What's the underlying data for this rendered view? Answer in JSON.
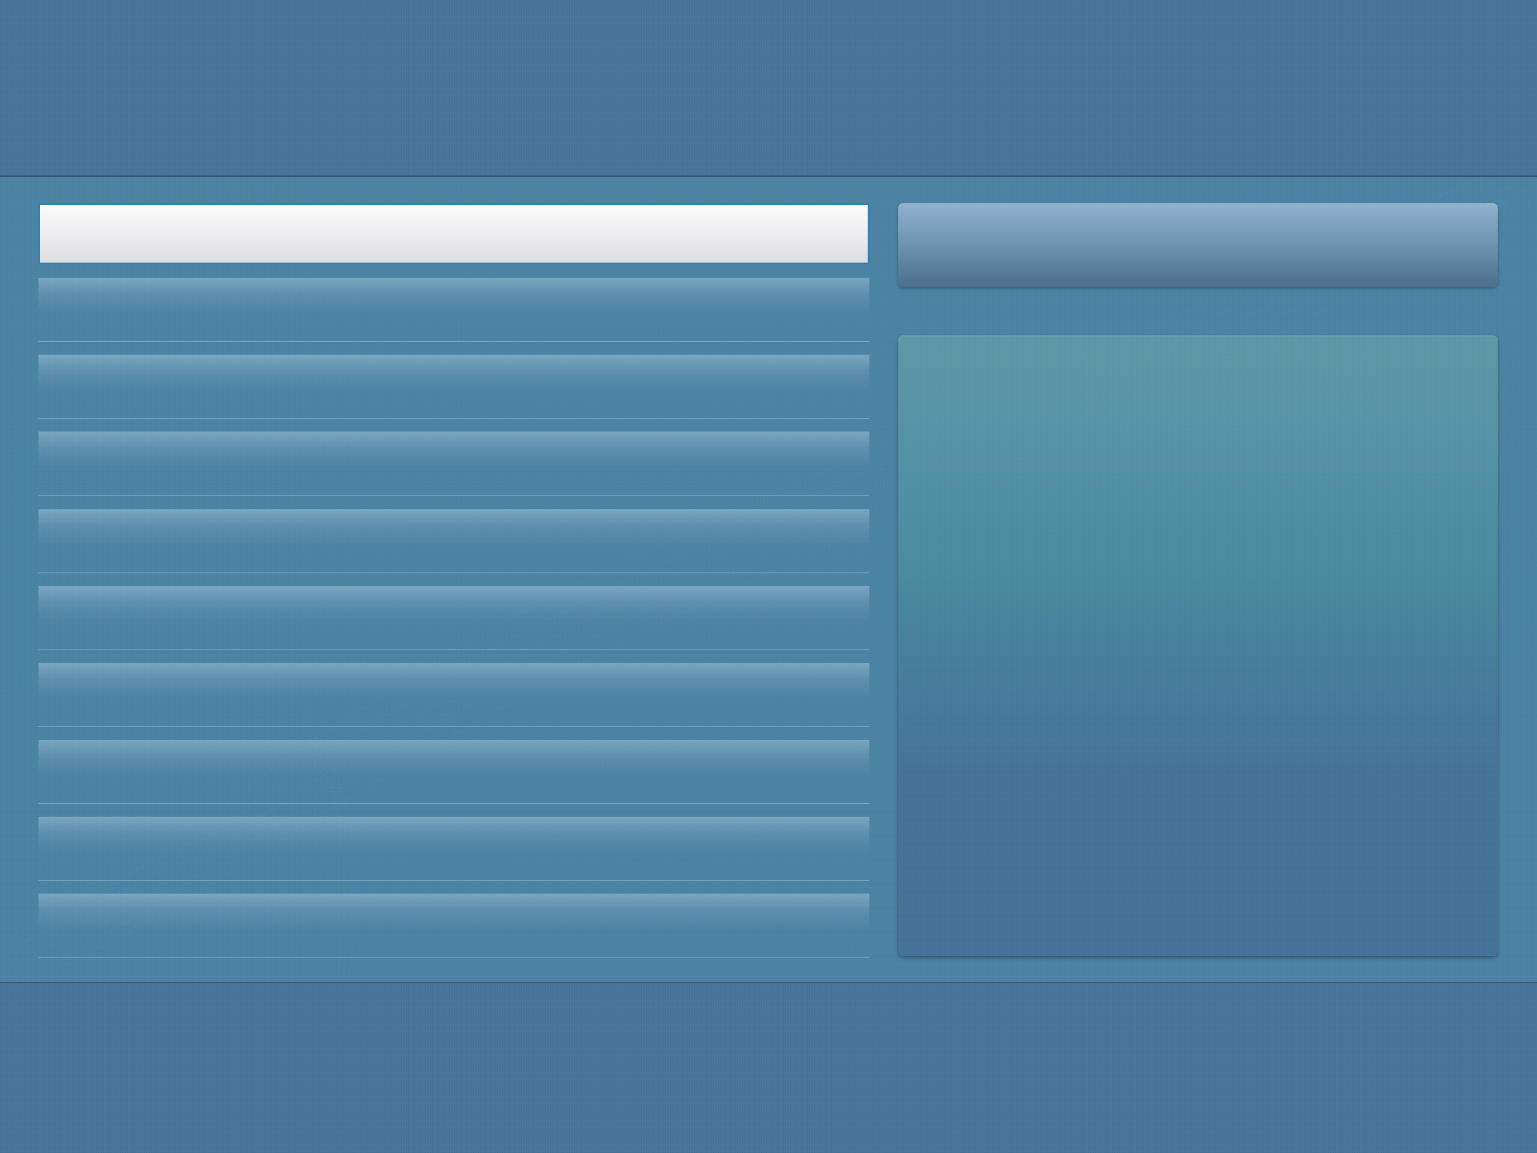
{
  "window": {
    "title": ""
  },
  "search": {
    "value": "",
    "placeholder": ""
  },
  "list": {
    "items": [
      {
        "label": ""
      },
      {
        "label": ""
      },
      {
        "label": ""
      },
      {
        "label": ""
      },
      {
        "label": ""
      },
      {
        "label": ""
      },
      {
        "label": ""
      },
      {
        "label": ""
      },
      {
        "label": ""
      }
    ]
  },
  "action": {
    "label": ""
  },
  "detail": {
    "text": ""
  },
  "colors": {
    "background": "#4a7797",
    "panel": "#4b84a4",
    "search_border": "#2d7fb8",
    "search_fill": "#ececee",
    "button_top": "#8fb2cc",
    "button_bottom": "#4d6f8b",
    "detail_top": "#5e99a8",
    "detail_bottom": "#45739a"
  },
  "icons": []
}
